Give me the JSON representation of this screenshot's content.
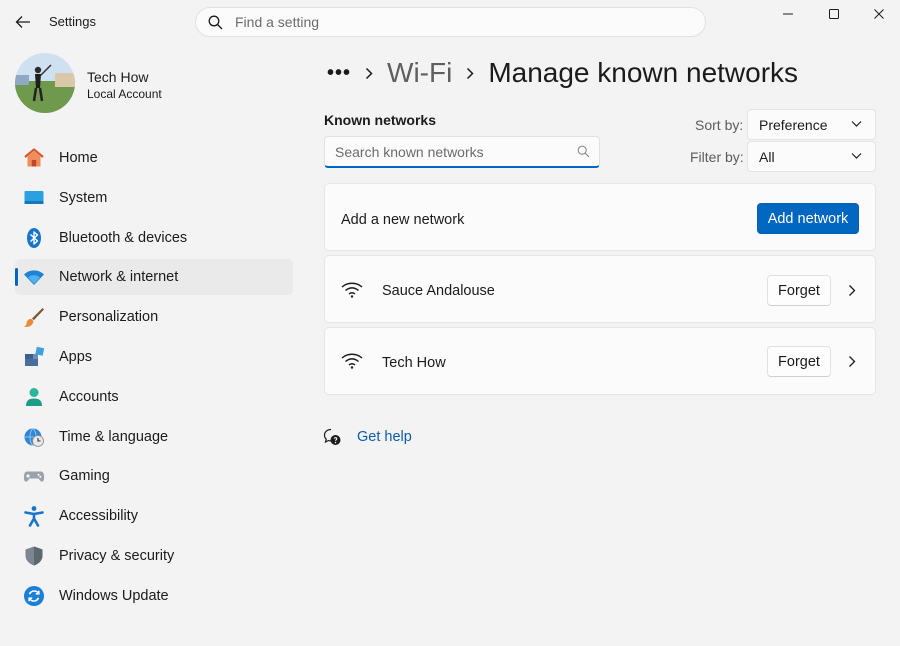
{
  "window": {
    "app_title": "Settings",
    "search_placeholder": "Find a setting"
  },
  "profile": {
    "name": "Tech How",
    "account_type": "Local Account"
  },
  "sidebar": {
    "items": [
      {
        "label": "Home",
        "icon": "home-icon"
      },
      {
        "label": "System",
        "icon": "system-icon"
      },
      {
        "label": "Bluetooth & devices",
        "icon": "bluetooth-icon"
      },
      {
        "label": "Network & internet",
        "icon": "wifi-icon",
        "active": true
      },
      {
        "label": "Personalization",
        "icon": "brush-icon"
      },
      {
        "label": "Apps",
        "icon": "apps-icon"
      },
      {
        "label": "Accounts",
        "icon": "person-icon"
      },
      {
        "label": "Time & language",
        "icon": "globe-clock-icon"
      },
      {
        "label": "Gaming",
        "icon": "gamepad-icon"
      },
      {
        "label": "Accessibility",
        "icon": "accessibility-icon"
      },
      {
        "label": "Privacy & security",
        "icon": "shield-icon"
      },
      {
        "label": "Windows Update",
        "icon": "update-icon"
      }
    ]
  },
  "breadcrumb": {
    "overflow": "•••",
    "parent": "Wi-Fi",
    "current": "Manage known networks"
  },
  "known_networks": {
    "heading": "Known networks",
    "search_placeholder": "Search known networks",
    "sort_label": "Sort by:",
    "sort_value": "Preference",
    "filter_label": "Filter by:",
    "filter_value": "All",
    "add_text": "Add a new network",
    "add_button": "Add network",
    "forget_label": "Forget",
    "networks": [
      {
        "name": "Sauce Andalouse"
      },
      {
        "name": "Tech How"
      }
    ]
  },
  "help": {
    "label": "Get help"
  },
  "colors": {
    "accent": "#0067c0",
    "background": "#f3f3f3",
    "card": "#fbfbfb",
    "link": "#0b5cad"
  }
}
